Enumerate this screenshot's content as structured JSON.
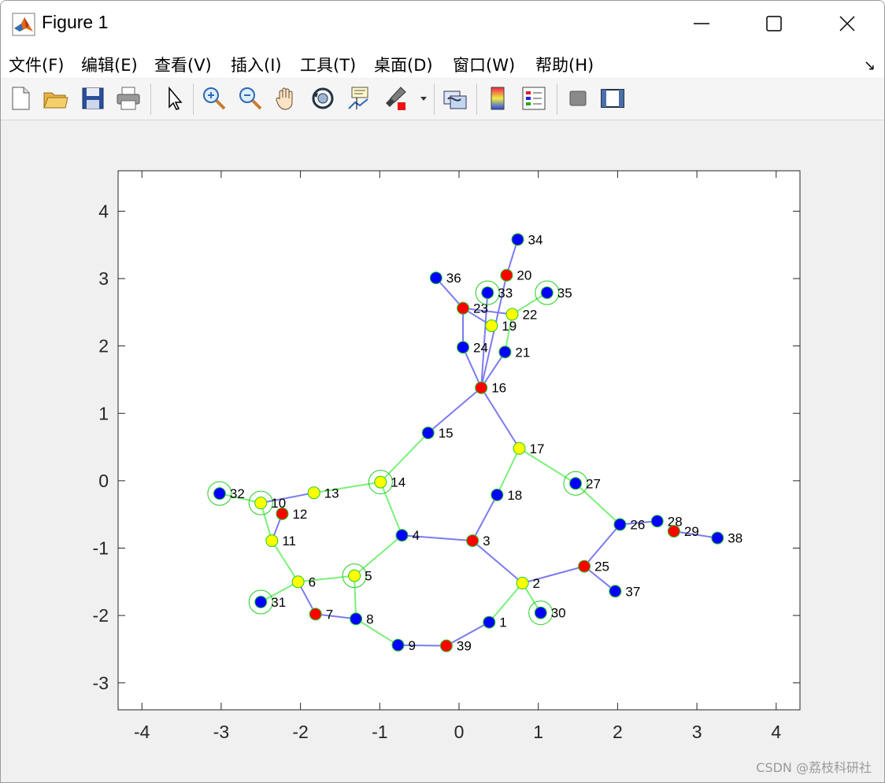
{
  "window": {
    "title": "Figure 1"
  },
  "menu": [
    "文件(F)",
    "编辑(E)",
    "查看(V)",
    "插入(I)",
    "工具(T)",
    "桌面(D)",
    "窗口(W)",
    "帮助(H)"
  ],
  "toolbar_icons": [
    "new-figure",
    "open-file",
    "save",
    "print",
    "select-arrow",
    "zoom-in",
    "zoom-out",
    "pan",
    "rotate-3d",
    "data-cursor",
    "brush",
    "brush-dropdown",
    "link-plot",
    "colorbar",
    "legend",
    "hide-plot-tools",
    "show-plot-tools"
  ],
  "watermark": "CSDN @荔枝科研社",
  "colors": {
    "blue": "#0000ff",
    "red": "#ff0000",
    "yellow": "#ffff00",
    "edge_blue": "#7b7bf0",
    "edge_green": "#7af07a",
    "ring": "#22cc22"
  },
  "chart_data": {
    "type": "scatter",
    "title": "",
    "xlabel": "",
    "ylabel": "",
    "xlim": [
      -4.3,
      4.3
    ],
    "ylim": [
      -3.4,
      4.6
    ],
    "xticks": [
      "-4",
      "-3",
      "-2",
      "-1",
      "0",
      "1",
      "2",
      "3",
      "4"
    ],
    "yticks": [
      "4",
      "3",
      "2",
      "1",
      "0",
      "-1",
      "-2",
      "-3"
    ],
    "nodes": [
      {
        "id": "1",
        "x": 0.38,
        "y": -2.1,
        "color": "blue",
        "ring": false
      },
      {
        "id": "2",
        "x": 0.8,
        "y": -1.52,
        "color": "yellow",
        "ring": false
      },
      {
        "id": "3",
        "x": 0.17,
        "y": -0.89,
        "color": "red",
        "ring": false
      },
      {
        "id": "4",
        "x": -0.72,
        "y": -0.81,
        "color": "blue",
        "ring": false
      },
      {
        "id": "5",
        "x": -1.32,
        "y": -1.41,
        "color": "yellow",
        "ring": true
      },
      {
        "id": "6",
        "x": -2.03,
        "y": -1.5,
        "color": "yellow",
        "ring": false
      },
      {
        "id": "7",
        "x": -1.81,
        "y": -1.98,
        "color": "red",
        "ring": false
      },
      {
        "id": "8",
        "x": -1.3,
        "y": -2.05,
        "color": "blue",
        "ring": false
      },
      {
        "id": "9",
        "x": -0.77,
        "y": -2.44,
        "color": "blue",
        "ring": false
      },
      {
        "id": "10",
        "x": -2.5,
        "y": -0.33,
        "color": "yellow",
        "ring": true
      },
      {
        "id": "11",
        "x": -2.36,
        "y": -0.89,
        "color": "yellow",
        "ring": false
      },
      {
        "id": "12",
        "x": -2.23,
        "y": -0.49,
        "color": "red",
        "ring": false
      },
      {
        "id": "13",
        "x": -1.83,
        "y": -0.18,
        "color": "yellow",
        "ring": false
      },
      {
        "id": "14",
        "x": -0.99,
        "y": -0.02,
        "color": "yellow",
        "ring": true
      },
      {
        "id": "15",
        "x": -0.39,
        "y": 0.71,
        "color": "blue",
        "ring": false
      },
      {
        "id": "16",
        "x": 0.28,
        "y": 1.38,
        "color": "red",
        "ring": false
      },
      {
        "id": "17",
        "x": 0.76,
        "y": 0.48,
        "color": "yellow",
        "ring": false
      },
      {
        "id": "18",
        "x": 0.48,
        "y": -0.21,
        "color": "blue",
        "ring": false
      },
      {
        "id": "19",
        "x": 0.41,
        "y": 2.3,
        "color": "yellow",
        "ring": false
      },
      {
        "id": "20",
        "x": 0.6,
        "y": 3.05,
        "color": "red",
        "ring": false
      },
      {
        "id": "21",
        "x": 0.58,
        "y": 1.91,
        "color": "blue",
        "ring": false
      },
      {
        "id": "22",
        "x": 0.67,
        "y": 2.47,
        "color": "yellow",
        "ring": false
      },
      {
        "id": "23",
        "x": 0.05,
        "y": 2.56,
        "color": "red",
        "ring": false
      },
      {
        "id": "24",
        "x": 0.05,
        "y": 1.98,
        "color": "blue",
        "ring": false
      },
      {
        "id": "25",
        "x": 1.58,
        "y": -1.27,
        "color": "red",
        "ring": false
      },
      {
        "id": "26",
        "x": 2.03,
        "y": -0.65,
        "color": "blue",
        "ring": false
      },
      {
        "id": "27",
        "x": 1.47,
        "y": -0.04,
        "color": "blue",
        "ring": true
      },
      {
        "id": "28",
        "x": 2.5,
        "y": -0.6,
        "color": "blue",
        "ring": false
      },
      {
        "id": "29",
        "x": 2.71,
        "y": -0.75,
        "color": "red",
        "ring": false
      },
      {
        "id": "30",
        "x": 1.03,
        "y": -1.96,
        "color": "blue",
        "ring": true
      },
      {
        "id": "31",
        "x": -2.5,
        "y": -1.8,
        "color": "blue",
        "ring": true
      },
      {
        "id": "32",
        "x": -3.02,
        "y": -0.19,
        "color": "blue",
        "ring": true
      },
      {
        "id": "33",
        "x": 0.36,
        "y": 2.79,
        "color": "blue",
        "ring": true
      },
      {
        "id": "34",
        "x": 0.74,
        "y": 3.58,
        "color": "blue",
        "ring": false
      },
      {
        "id": "35",
        "x": 1.11,
        "y": 2.79,
        "color": "blue",
        "ring": true
      },
      {
        "id": "36",
        "x": -0.29,
        "y": 3.01,
        "color": "blue",
        "ring": false
      },
      {
        "id": "37",
        "x": 1.97,
        "y": -1.64,
        "color": "blue",
        "ring": false
      },
      {
        "id": "38",
        "x": 3.26,
        "y": -0.85,
        "color": "blue",
        "ring": false
      },
      {
        "id": "39",
        "x": -0.16,
        "y": -2.45,
        "color": "red",
        "ring": false
      }
    ],
    "edges": [
      {
        "from": "1",
        "to": "2",
        "color": "green"
      },
      {
        "from": "1",
        "to": "39",
        "color": "blue"
      },
      {
        "from": "2",
        "to": "3",
        "color": "blue"
      },
      {
        "from": "2",
        "to": "30",
        "color": "green"
      },
      {
        "from": "2",
        "to": "25",
        "color": "blue"
      },
      {
        "from": "3",
        "to": "4",
        "color": "blue"
      },
      {
        "from": "3",
        "to": "18",
        "color": "blue"
      },
      {
        "from": "4",
        "to": "5",
        "color": "green"
      },
      {
        "from": "4",
        "to": "14",
        "color": "green"
      },
      {
        "from": "5",
        "to": "6",
        "color": "green"
      },
      {
        "from": "5",
        "to": "8",
        "color": "green"
      },
      {
        "from": "6",
        "to": "7",
        "color": "blue"
      },
      {
        "from": "6",
        "to": "11",
        "color": "green"
      },
      {
        "from": "6",
        "to": "31",
        "color": "green"
      },
      {
        "from": "7",
        "to": "8",
        "color": "blue"
      },
      {
        "from": "8",
        "to": "9",
        "color": "green"
      },
      {
        "from": "9",
        "to": "39",
        "color": "blue"
      },
      {
        "from": "10",
        "to": "11",
        "color": "green"
      },
      {
        "from": "10",
        "to": "32",
        "color": "green"
      },
      {
        "from": "10",
        "to": "13",
        "color": "blue"
      },
      {
        "from": "11",
        "to": "12",
        "color": "blue"
      },
      {
        "from": "13",
        "to": "14",
        "color": "green"
      },
      {
        "from": "14",
        "to": "15",
        "color": "green"
      },
      {
        "from": "15",
        "to": "16",
        "color": "blue"
      },
      {
        "from": "16",
        "to": "17",
        "color": "blue"
      },
      {
        "from": "16",
        "to": "21",
        "color": "blue"
      },
      {
        "from": "16",
        "to": "24",
        "color": "blue"
      },
      {
        "from": "16",
        "to": "33",
        "color": "blue"
      },
      {
        "from": "16",
        "to": "20",
        "color": "blue"
      },
      {
        "from": "17",
        "to": "18",
        "color": "green"
      },
      {
        "from": "17",
        "to": "27",
        "color": "green"
      },
      {
        "from": "19",
        "to": "23",
        "color": "blue"
      },
      {
        "from": "21",
        "to": "22",
        "color": "green"
      },
      {
        "from": "22",
        "to": "35",
        "color": "green"
      },
      {
        "from": "22",
        "to": "23",
        "color": "blue"
      },
      {
        "from": "23",
        "to": "24",
        "color": "blue"
      },
      {
        "from": "23",
        "to": "36",
        "color": "blue"
      },
      {
        "from": "20",
        "to": "34",
        "color": "blue"
      },
      {
        "from": "25",
        "to": "26",
        "color": "blue"
      },
      {
        "from": "25",
        "to": "37",
        "color": "blue"
      },
      {
        "from": "26",
        "to": "27",
        "color": "green"
      },
      {
        "from": "26",
        "to": "28",
        "color": "blue"
      },
      {
        "from": "29",
        "to": "38",
        "color": "blue"
      }
    ]
  }
}
